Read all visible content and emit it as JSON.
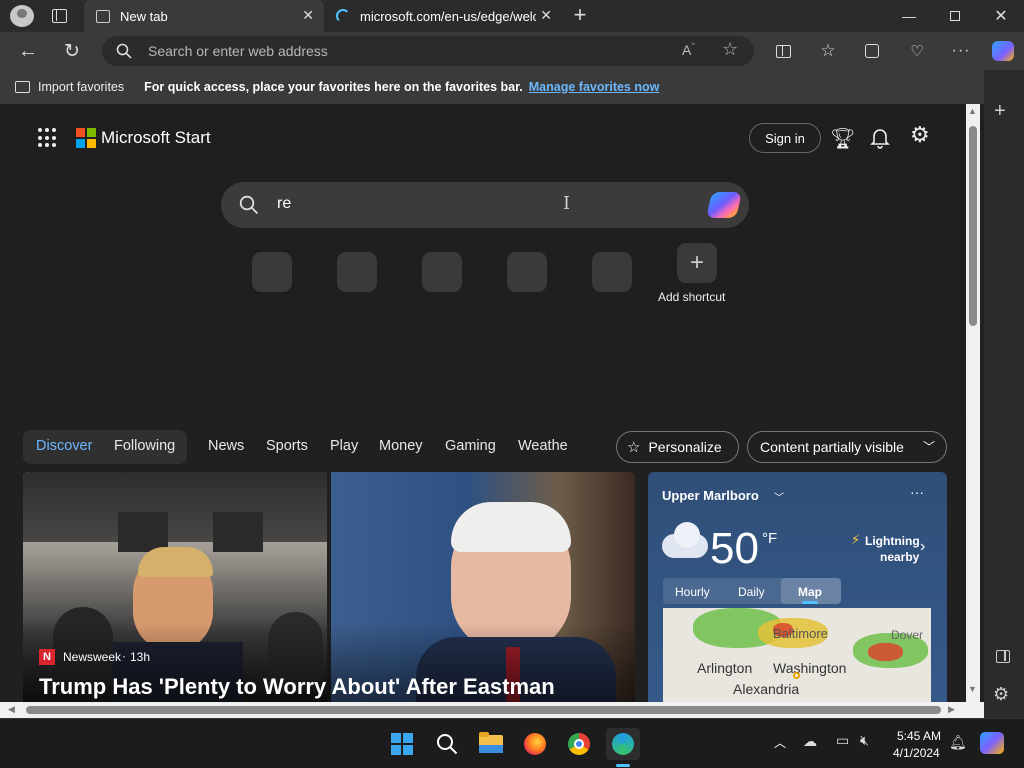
{
  "tabs": [
    {
      "title": "New tab",
      "active": true
    },
    {
      "title": "microsoft.com/en-us/edge/welc",
      "active": false
    }
  ],
  "addressbar": {
    "placeholder": "Search or enter web address"
  },
  "favorites_bar": {
    "import_label": "Import favorites",
    "hint_text": "For quick access, place your favorites here on the favorites bar.",
    "manage_link": "Manage favorites now"
  },
  "page": {
    "brand": "Microsoft Start",
    "sign_in": "Sign in",
    "search_value": "re",
    "add_shortcut": "Add shortcut",
    "feed_tabs": [
      "Discover",
      "Following",
      "News",
      "Sports",
      "Play",
      "Money",
      "Gaming",
      "Weathe"
    ],
    "active_feed_tab": "Discover",
    "personalize": "Personalize",
    "content_visibility": "Content partially visible",
    "news": {
      "source": "Newsweek",
      "age": "13h",
      "headline": "Trump Has 'Plenty to Worry About' After Eastman"
    },
    "weather": {
      "location": "Upper Marlboro",
      "temperature": "50",
      "unit": "°F",
      "alert_line1": "Lightning",
      "alert_line2": "nearby",
      "tabs": [
        "Hourly",
        "Daily",
        "Map"
      ],
      "active_tab": "Map",
      "map_labels": [
        "Baltimore",
        "Dover",
        "Arlington",
        "Washington",
        "Alexandria"
      ]
    }
  },
  "taskbar": {
    "time": "5:45 AM",
    "date": "4/1/2024"
  },
  "colors": {
    "accent": "#4cc2ff",
    "link": "#6cb8ff",
    "page_bg": "#1f1f1f"
  }
}
